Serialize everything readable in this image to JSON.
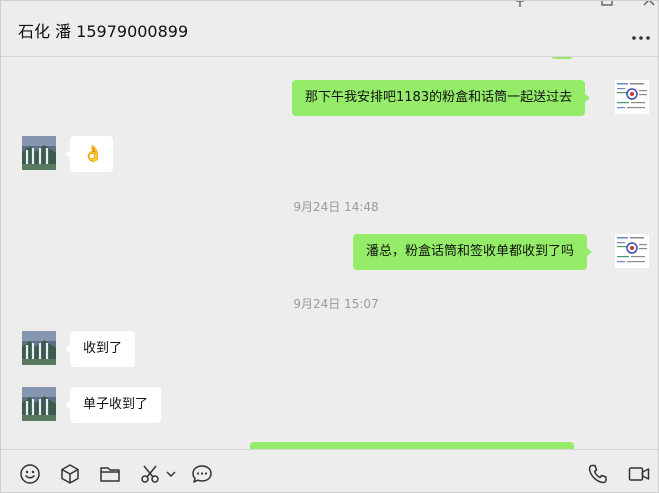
{
  "chat": {
    "title": "石化 潘 15979000899"
  },
  "window_controls": [
    "pin-icon",
    "maximize-icon",
    "close-icon"
  ],
  "messages": {
    "m1": {
      "sender": "me",
      "text": "那下午我安排吧1183的粉盒和话筒一起送过去"
    },
    "m2": {
      "sender": "contact",
      "text": "👌"
    },
    "t1": "9月24日 14:48",
    "m3": {
      "sender": "me",
      "text": "潘总，粉盒话筒和签收单都收到了吗"
    },
    "t2": "9月24日 15:07",
    "m4": {
      "sender": "contact",
      "text": "收到了"
    },
    "m5": {
      "sender": "contact",
      "text": "单子收到了"
    }
  },
  "toolbar": {
    "left_icons": [
      "emoji-icon",
      "box-icon",
      "folder-icon",
      "scissors-icon",
      "chevron-down-icon",
      "chat-bubble-icon"
    ],
    "right_icons": [
      "phone-icon",
      "video-icon"
    ]
  },
  "colors": {
    "my_bubble": "#95ec69",
    "their_bubble": "#ffffff",
    "background": "#ededed",
    "timestamp": "#9a9a9a"
  }
}
